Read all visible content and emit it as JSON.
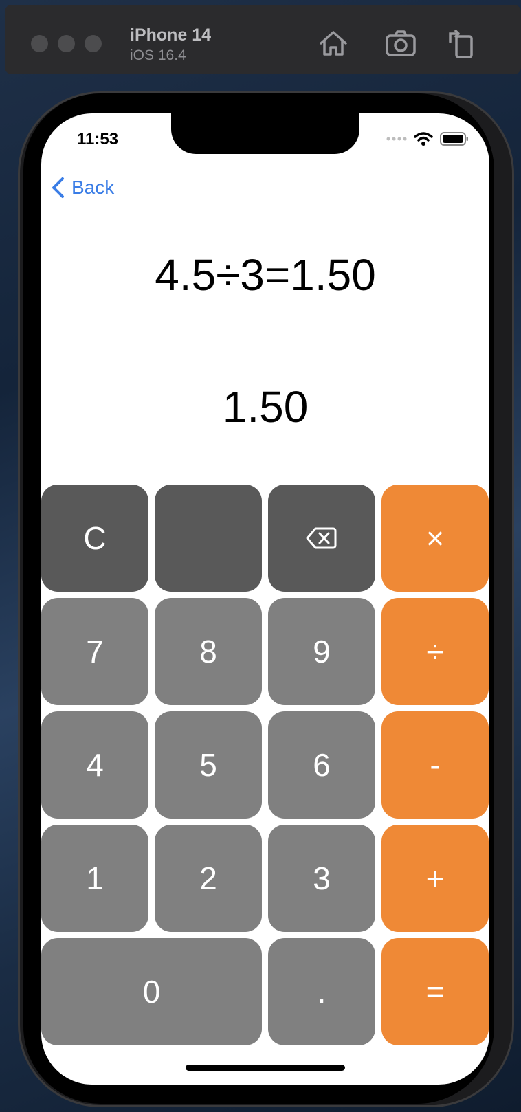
{
  "simulator": {
    "device_name": "iPhone 14",
    "os_version": "iOS 16.4",
    "toolbar_icons": [
      "home-icon",
      "screenshot-icon",
      "rotate-icon"
    ]
  },
  "status_bar": {
    "time": "11:53",
    "icons": [
      "signal-icon",
      "wifi-icon",
      "battery-icon"
    ]
  },
  "nav": {
    "back_label": "Back"
  },
  "display": {
    "expression": "4.5÷3=1.50",
    "result": "1.50"
  },
  "keypad": {
    "clear": "C",
    "blank": "",
    "backspace_icon": "backspace-icon",
    "multiply": "×",
    "divide": "÷",
    "subtract": "-",
    "add": "+",
    "equals": "=",
    "seven": "7",
    "eight": "8",
    "nine": "9",
    "four": "4",
    "five": "5",
    "six": "6",
    "one": "1",
    "two": "2",
    "three": "3",
    "zero": "0",
    "decimal": "."
  },
  "colors": {
    "function_key": "#595959",
    "number_key": "#808080",
    "operator_key": "#ef8936",
    "link": "#3a7de6"
  }
}
